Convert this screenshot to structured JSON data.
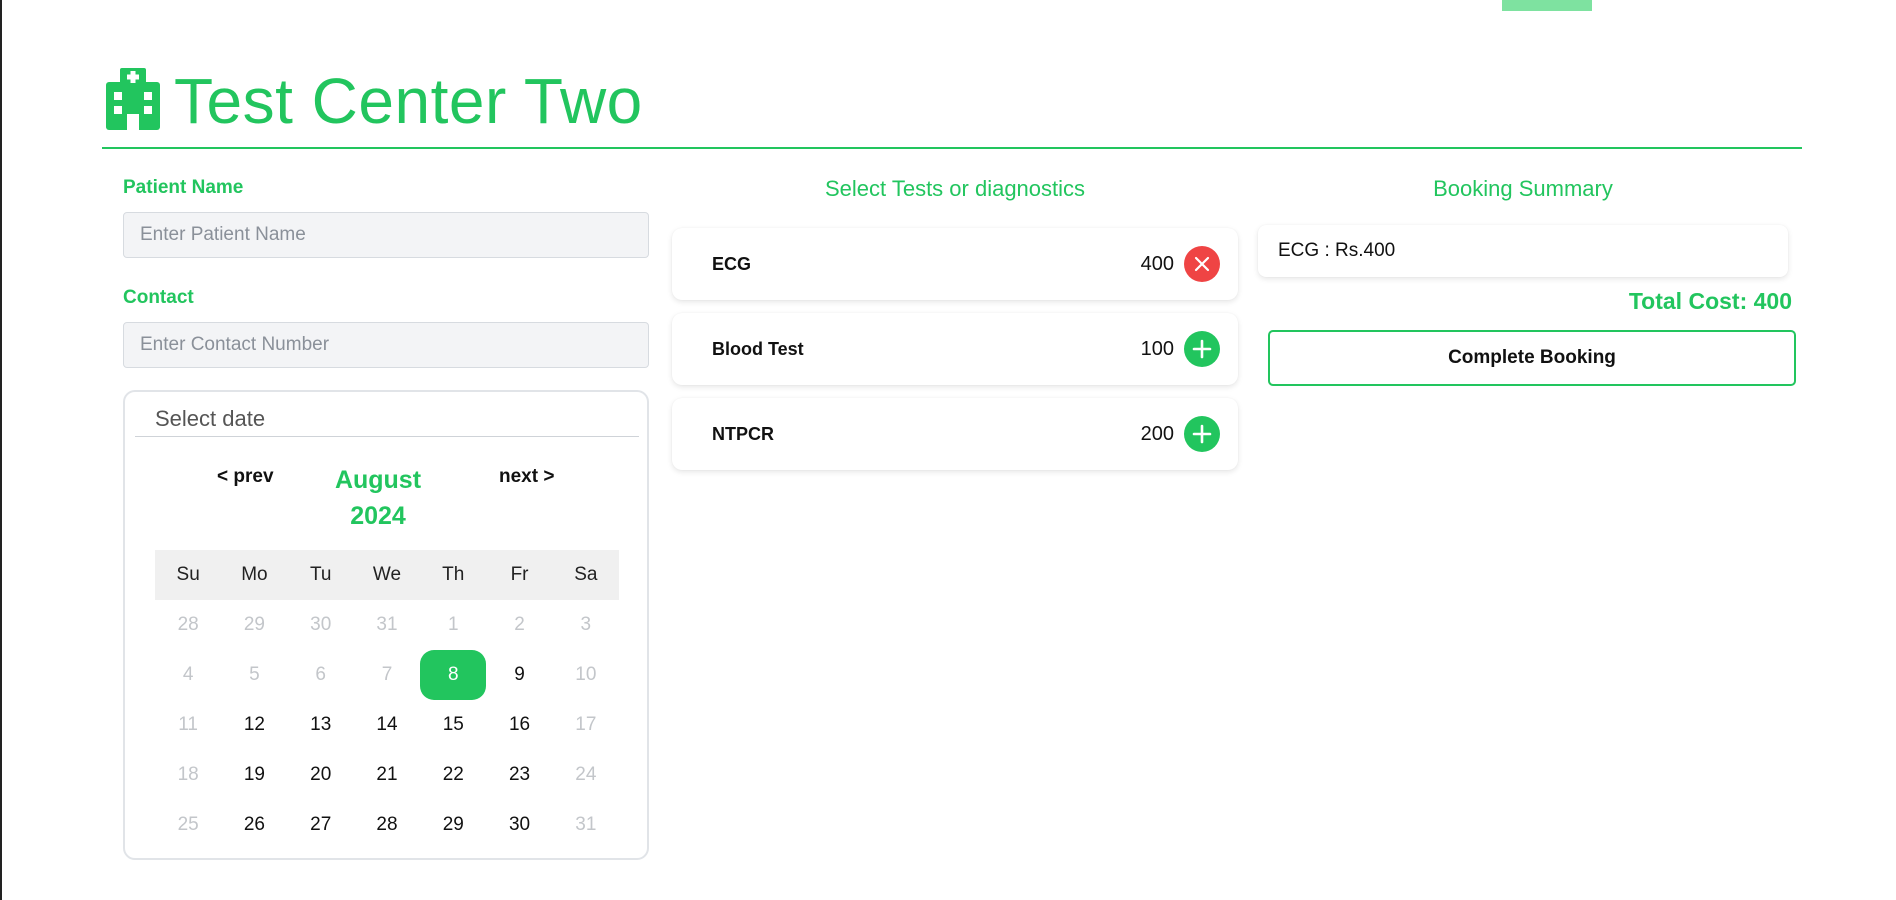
{
  "colors": {
    "accent": "#22c55e",
    "danger": "#ef4444",
    "muted_day": "#c3c6ca"
  },
  "header": {
    "title": "Test Center Two",
    "icon": "hospital-icon"
  },
  "form": {
    "patient_label": "Patient Name",
    "patient_placeholder": "Enter Patient Name",
    "patient_value": "",
    "contact_label": "Contact",
    "contact_placeholder": "Enter Contact Number",
    "contact_value": ""
  },
  "calendar": {
    "label": "Select date",
    "prev": "< prev",
    "next": "next >",
    "month": "August",
    "year": "2024",
    "weekdays": [
      "Su",
      "Mo",
      "Tu",
      "We",
      "Th",
      "Fr",
      "Sa"
    ],
    "selected_day": "8",
    "days": [
      {
        "d": "28",
        "muted": true
      },
      {
        "d": "29",
        "muted": true
      },
      {
        "d": "30",
        "muted": true
      },
      {
        "d": "31",
        "muted": true
      },
      {
        "d": "1",
        "muted": true
      },
      {
        "d": "2",
        "muted": true
      },
      {
        "d": "3",
        "muted": true
      },
      {
        "d": "4",
        "muted": true
      },
      {
        "d": "5",
        "muted": true
      },
      {
        "d": "6",
        "muted": true
      },
      {
        "d": "7",
        "muted": true
      },
      {
        "d": "8",
        "muted": false,
        "selected": true
      },
      {
        "d": "9",
        "muted": false
      },
      {
        "d": "10",
        "muted": true
      },
      {
        "d": "11",
        "muted": true
      },
      {
        "d": "12",
        "muted": false
      },
      {
        "d": "13",
        "muted": false
      },
      {
        "d": "14",
        "muted": false
      },
      {
        "d": "15",
        "muted": false
      },
      {
        "d": "16",
        "muted": false
      },
      {
        "d": "17",
        "muted": true
      },
      {
        "d": "18",
        "muted": true
      },
      {
        "d": "19",
        "muted": false
      },
      {
        "d": "20",
        "muted": false
      },
      {
        "d": "21",
        "muted": false
      },
      {
        "d": "22",
        "muted": false
      },
      {
        "d": "23",
        "muted": false
      },
      {
        "d": "24",
        "muted": true
      },
      {
        "d": "25",
        "muted": true
      },
      {
        "d": "26",
        "muted": false
      },
      {
        "d": "27",
        "muted": false
      },
      {
        "d": "28",
        "muted": false
      },
      {
        "d": "29",
        "muted": false
      },
      {
        "d": "30",
        "muted": false
      },
      {
        "d": "31",
        "muted": true
      }
    ]
  },
  "tests": {
    "title": "Select Tests or diagnostics",
    "items": [
      {
        "name": "ECG",
        "price": "400",
        "action": "remove",
        "icon": "close-icon"
      },
      {
        "name": "Blood Test",
        "price": "100",
        "action": "add",
        "icon": "plus-icon"
      },
      {
        "name": "NTPCR",
        "price": "200",
        "action": "add",
        "icon": "plus-icon"
      }
    ]
  },
  "summary": {
    "title": "Booking Summary",
    "items": [
      "ECG : Rs.400"
    ],
    "total": "Total Cost: 400",
    "button": "Complete Booking"
  }
}
